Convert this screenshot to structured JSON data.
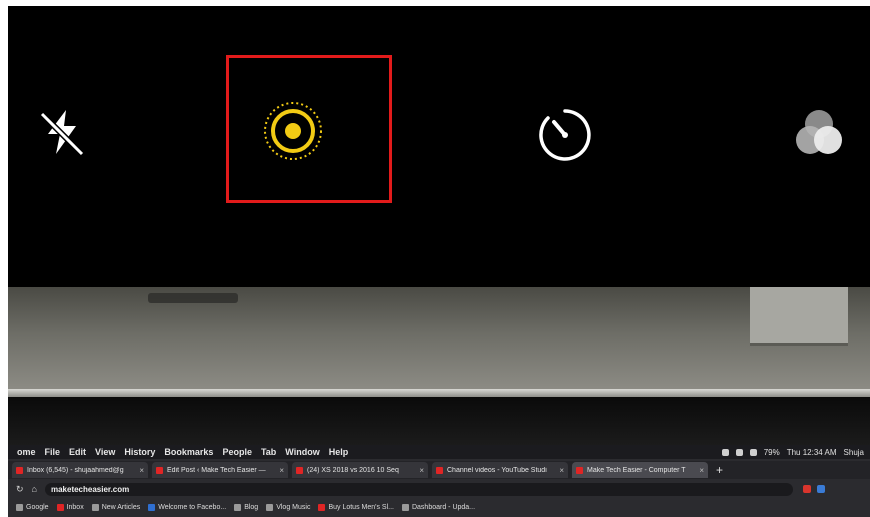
{
  "camera": {
    "icons": {
      "flash": "flash-off-icon",
      "live": "live-photo-icon",
      "timer": "timer-icon",
      "filters": "filters-icon"
    },
    "colors": {
      "live_active": "#f2cb14",
      "highlight_border": "#e21b1b",
      "icon_white": "#ffffff"
    }
  },
  "browser": {
    "menu": [
      "ome",
      "File",
      "Edit",
      "View",
      "History",
      "Bookmarks",
      "People",
      "Tab",
      "Window",
      "Help"
    ],
    "status": {
      "battery": "79%",
      "clock": "Thu 12:34 AM",
      "user": "Shuja"
    },
    "tabs": [
      {
        "title": "Inbox (6,545) - shujaahmed@g",
        "active": false
      },
      {
        "title": "Edit Post ‹ Make Tech Easier —",
        "active": false
      },
      {
        "title": "(24) XS 2018 vs 2016 10 Seq",
        "active": false
      },
      {
        "title": "Channel videos - YouTube Studi",
        "active": false
      },
      {
        "title": "Make Tech Easier - Computer T",
        "active": true
      }
    ],
    "new_tab": "+",
    "address": "maketecheasier.com",
    "bookmarks": [
      "Google",
      "Inbox",
      "New Articles",
      "Welcome to Facebo...",
      "Blog",
      "Vlog Music",
      "Buy Lotus Men's Sl...",
      "Dashboard - Upda..."
    ]
  }
}
